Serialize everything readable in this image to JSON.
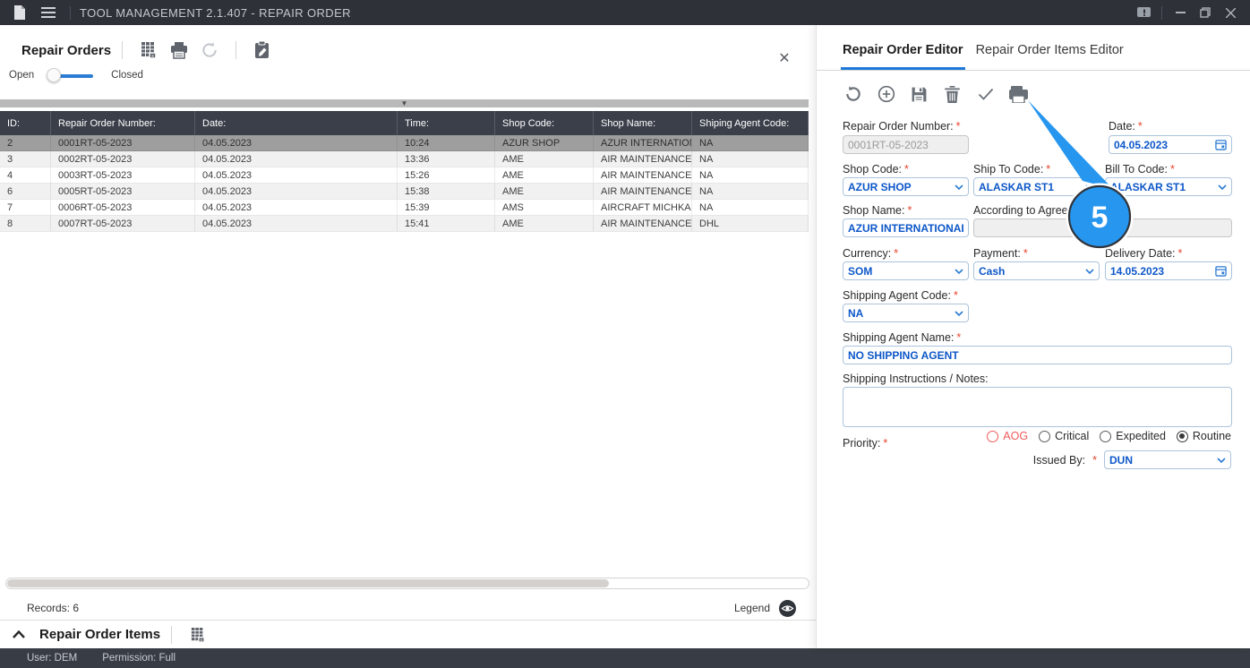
{
  "titlebar": {
    "title": "TOOL MANAGEMENT 2.1.407 - REPAIR ORDER",
    "window_controls": {
      "minimize": "–",
      "restore": "restore",
      "close": "✕"
    }
  },
  "icons": {
    "document-icon": "page glyph",
    "hamburger-icon": "three lines",
    "feedback-icon": "speech bubble with !",
    "export-excel-icon": "grid with x",
    "print-icon": "printer",
    "refresh-icon": "circular arrow",
    "edit-clipboard-icon": "clipboard with pencil",
    "add-icon": "plus in circle",
    "save-icon": "floppy disk",
    "delete-icon": "trash bin",
    "validate-icon": "checkmark",
    "legend-eye-icon": "eye in dark circle",
    "calendar-icon": "calendar",
    "chevron-down-icon": "⌄",
    "collapse-triangle": "▼",
    "caret-up": "∧"
  },
  "repair_orders": {
    "title": "Repair Orders",
    "toggle": {
      "left_label": "Open",
      "right_label": "Closed",
      "state": "Open"
    },
    "table": {
      "columns": [
        "ID:",
        "Repair Order Number:",
        "Date:",
        "Time:",
        "Shop Code:",
        "Shop Name:",
        "Shiping Agent Code:"
      ],
      "rows": [
        [
          "2",
          "0001RT-05-2023",
          "04.05.2023",
          "10:24",
          "AZUR SHOP",
          "AZUR INTERNATION...",
          "NA"
        ],
        [
          "3",
          "0002RT-05-2023",
          "04.05.2023",
          "13:36",
          "AME",
          "AIR MAINTENANCE E...",
          "NA"
        ],
        [
          "4",
          "0003RT-05-2023",
          "04.05.2023",
          "15:26",
          "AME",
          "AIR MAINTENANCE E...",
          "NA"
        ],
        [
          "6",
          "0005RT-05-2023",
          "04.05.2023",
          "15:38",
          "AME",
          "AIR MAINTENANCE E...",
          "NA"
        ],
        [
          "7",
          "0006RT-05-2023",
          "04.05.2023",
          "15:39",
          "AMS",
          "AIRCRAFT MICHKAS...",
          "NA"
        ],
        [
          "8",
          "0007RT-05-2023",
          "04.05.2023",
          "15:41",
          "AME",
          "AIR MAINTENANCE E...",
          "DHL"
        ]
      ],
      "selected_row_index": 0
    },
    "records_label": "Records: 6",
    "legend_label": "Legend"
  },
  "repair_order_items": {
    "title": "Repair Order Items"
  },
  "statusbar": {
    "user": "User: DEM",
    "permission": "Permission: Full"
  },
  "editor": {
    "tabs": [
      {
        "label": "Repair Order Editor",
        "active": true
      },
      {
        "label": "Repair Order Items Editor",
        "active": false
      }
    ],
    "required_marker": "*",
    "fields": {
      "repair_order_number": {
        "label": "Repair Order Number:",
        "value": "0001RT-05-2023",
        "disabled": true
      },
      "date": {
        "label": "Date:",
        "value": "04.05.2023"
      },
      "shop_code": {
        "label": "Shop Code:",
        "value": "AZUR SHOP"
      },
      "ship_to_code": {
        "label": "Ship To Code:",
        "value": "ALASKAR ST1"
      },
      "bill_to_code": {
        "label": "Bill To Code:",
        "value": "ALASKAR ST1"
      },
      "shop_name": {
        "label": "Shop Name:",
        "value": "AZUR INTERNATIONAL COM"
      },
      "according_to_agreement": {
        "label": "According to Agreement:",
        "value": "",
        "disabled": true
      },
      "currency": {
        "label": "Currency:",
        "value": "SOM"
      },
      "payment": {
        "label": "Payment:",
        "value": "Cash"
      },
      "delivery_date": {
        "label": "Delivery Date:",
        "value": "14.05.2023"
      },
      "shipping_agent_code": {
        "label": "Shipping Agent Code:",
        "value": "NA"
      },
      "shipping_agent_name": {
        "label": "Shipping Agent Name:",
        "value": "NO SHIPPING AGENT"
      },
      "shipping_instructions": {
        "label": "Shipping Instructions / Notes:",
        "value": ""
      },
      "priority": {
        "label": "Priority:",
        "options": [
          "AOG",
          "Critical",
          "Expedited",
          "Routine"
        ],
        "selected": "Routine"
      },
      "issued_by": {
        "label": "Issued By:",
        "value": "DUN"
      }
    }
  },
  "callout": {
    "number": "5"
  },
  "colors": {
    "titlebar_bg": "#2e3138",
    "grid_header_bg": "#3a3f4a",
    "selected_row_bg": "#9e9e9e",
    "accent_blue": "#1e78d7",
    "field_value_blue": "#0d57c8",
    "required_red": "#e8442c",
    "callout_blue": "#2796ee"
  }
}
